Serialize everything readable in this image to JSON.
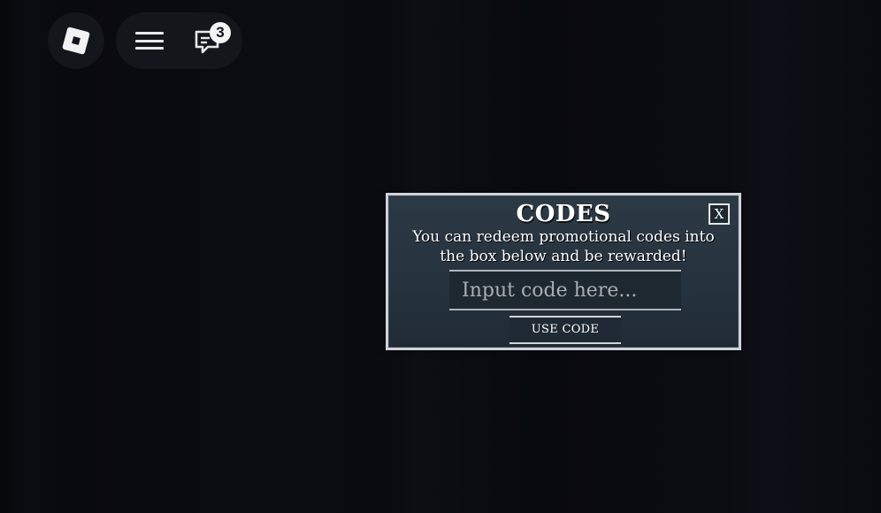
{
  "topbar": {
    "logo_icon": "roblox-logo-icon",
    "menu_icon": "hamburger-menu-icon",
    "chat_icon": "chat-icon",
    "chat_badge_count": "3"
  },
  "codes_panel": {
    "title": "CODES",
    "close_label": "X",
    "description": "You can redeem promotional codes into the box below and be rewarded!",
    "input_placeholder": "Input code here...",
    "input_value": "",
    "button_label": "USE CODE"
  },
  "colors": {
    "background": "#0a0b10",
    "panel_bg": "#26323d",
    "panel_border": "#cfd3d8",
    "text": "#ffffff"
  }
}
